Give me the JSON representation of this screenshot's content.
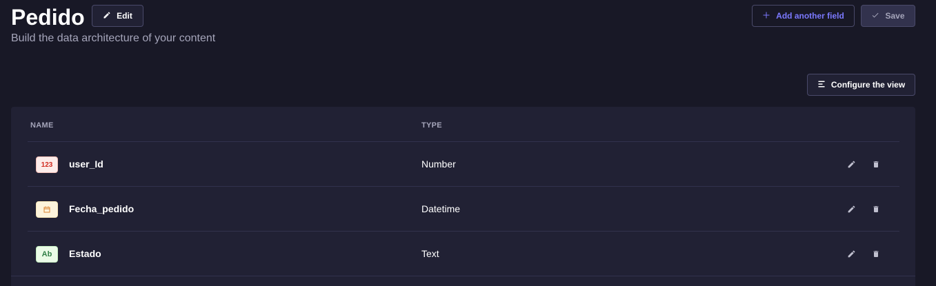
{
  "header": {
    "title": "Pedido",
    "subtitle": "Build the data architecture of your content",
    "edit_label": "Edit",
    "add_field_label": "Add another field",
    "save_label": "Save"
  },
  "toolbar": {
    "configure_label": "Configure the view"
  },
  "table": {
    "columns": [
      "NAME",
      "TYPE"
    ],
    "rows": [
      {
        "name": "user_Id",
        "type": "Number",
        "badge": "123",
        "icon": "number-icon"
      },
      {
        "name": "Fecha_pedido",
        "type": "Datetime",
        "badge": "",
        "icon": "calendar-icon"
      },
      {
        "name": "Estado",
        "type": "Text",
        "badge": "Ab",
        "icon": "text-icon"
      }
    ]
  },
  "colors": {
    "background": "#181826",
    "card": "#212134",
    "accent": "#7b79ff",
    "muted_text": "#a5a5ba"
  }
}
